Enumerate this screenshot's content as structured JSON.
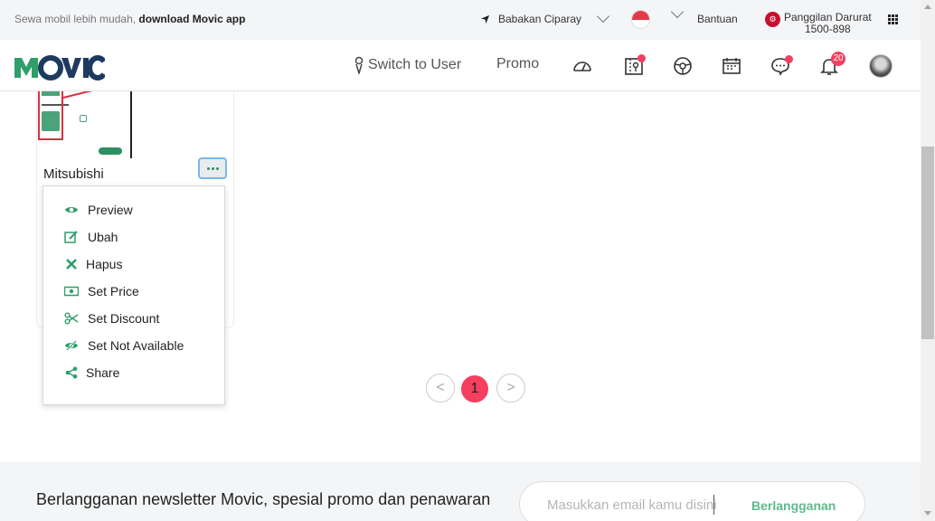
{
  "topbar": {
    "promo_prefix": "Sewa mobil lebih mudah,",
    "promo_link": "download Movic app",
    "location": "Babakan Ciparay",
    "help": "Bantuan",
    "emergency_line1": "Panggilan Darurat",
    "emergency_line2": "1500-898"
  },
  "navbar": {
    "logo": "MOVIC",
    "switch_label": "Switch to User",
    "promo_label": "Promo",
    "notification_count": "20",
    "icons": [
      "dashboard-icon",
      "map-icon",
      "steering-wheel-icon",
      "calendar-icon",
      "chat-icon",
      "bell-icon"
    ]
  },
  "card": {
    "title": "Mitsubishi",
    "more_label": "..."
  },
  "menu": {
    "items": [
      {
        "label": "Preview",
        "icon": "eye-icon"
      },
      {
        "label": "Ubah",
        "icon": "edit-icon"
      },
      {
        "label": "Hapus",
        "icon": "close-icon"
      },
      {
        "label": "Set Price",
        "icon": "money-icon"
      },
      {
        "label": "Set Discount",
        "icon": "scissors-icon"
      },
      {
        "label": "Set Not Available",
        "icon": "eye-slash-icon"
      },
      {
        "label": "Share",
        "icon": "share-icon"
      }
    ]
  },
  "pagination": {
    "prev": "<",
    "current": "1",
    "next": ">"
  },
  "newsletter": {
    "text": "Berlangganan newsletter Movic, spesial promo dan penawaran",
    "placeholder": "Masukkan email kamu disini",
    "button": "Berlangganan"
  },
  "colors": {
    "brand_green": "#2f9e6a",
    "accent_red": "#f43f5e",
    "logo_navy": "#1e3a5f"
  }
}
